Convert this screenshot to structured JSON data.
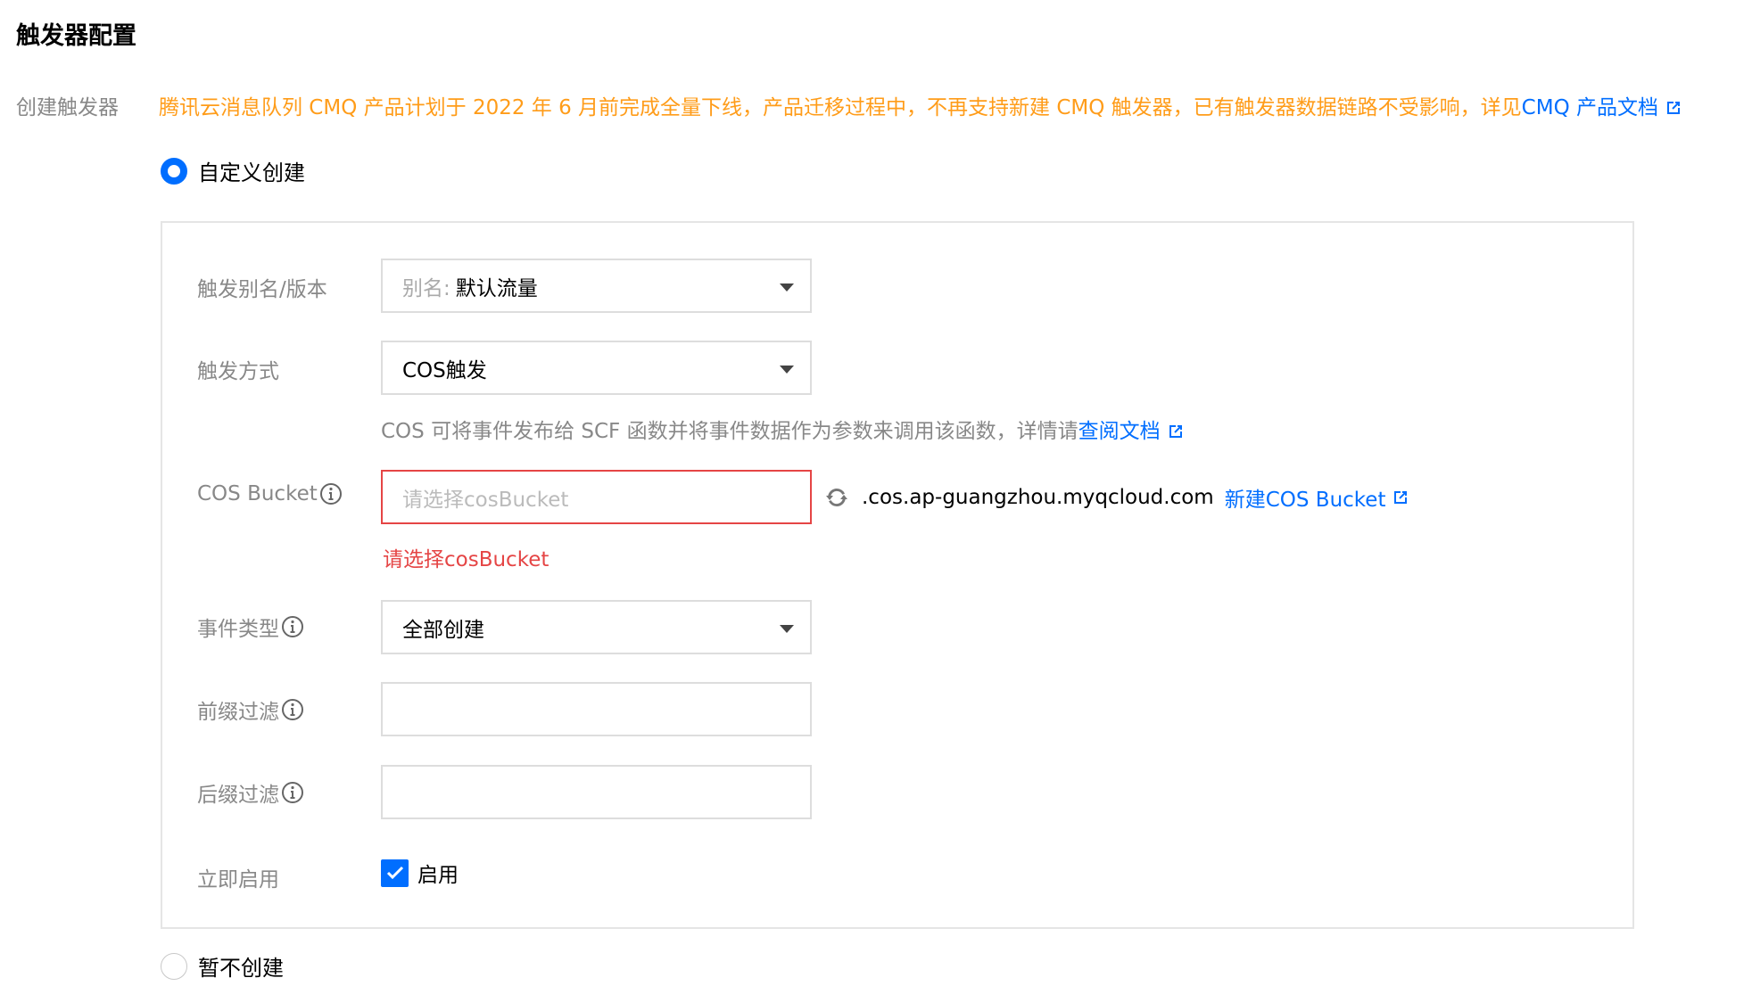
{
  "section_title": "触发器配置",
  "create_trigger_label": "创建触发器",
  "notice": {
    "text": "腾讯云消息队列 CMQ 产品计划于 2022 年 6 月前完成全量下线，产品迁移过程中，不再支持新建 CMQ 触发器，已有触发器数据链路不受影响，详见",
    "link": "CMQ 产品文档"
  },
  "options": {
    "custom_create": "自定义创建",
    "skip_create": "暂不创建"
  },
  "form": {
    "alias_version": {
      "label": "触发别名/版本",
      "prefix": "别名:",
      "value": "默认流量"
    },
    "trigger_method": {
      "label": "触发方式",
      "value": "COS触发"
    },
    "hint": {
      "text": "COS 可将事件发布给 SCF 函数并将事件数据作为参数来调用该函数，详情请",
      "link": "查阅文档"
    },
    "cos_bucket": {
      "label": "COS Bucket",
      "placeholder": "请选择cosBucket",
      "error": "请选择cosBucket",
      "domain_suffix": ".cos.ap-guangzhou.myqcloud.com",
      "new_link": "新建COS Bucket"
    },
    "event_type": {
      "label": "事件类型",
      "value": "全部创建"
    },
    "prefix_filter": {
      "label": "前缀过滤",
      "value": ""
    },
    "suffix_filter": {
      "label": "后缀过滤",
      "value": ""
    },
    "enable_now": {
      "label": "立即启用",
      "checkbox_label": "启用",
      "checked": true
    }
  },
  "colors": {
    "primary": "#006eff",
    "warning": "#ff9c19",
    "error": "#e54545",
    "label": "#888888"
  }
}
